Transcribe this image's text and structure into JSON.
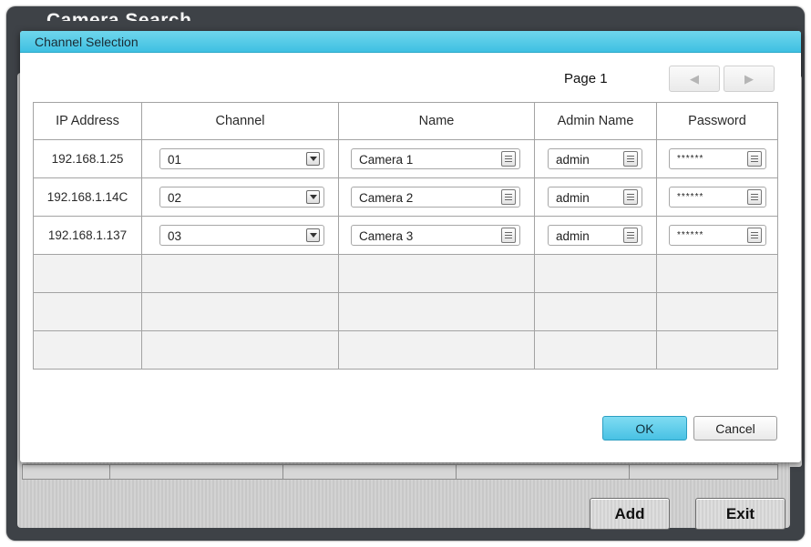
{
  "background_window": {
    "title": "Camera Search",
    "buttons": {
      "add": "Add",
      "exit": "Exit"
    }
  },
  "dialog": {
    "title": "Channel Selection",
    "page_label": "Page 1",
    "nav": {
      "prev_icon": "triangle-left",
      "next_icon": "triangle-right"
    },
    "columns": [
      "IP Address",
      "Channel",
      "Name",
      "Admin Name",
      "Password"
    ],
    "rows": [
      {
        "ip": "192.168.1.25",
        "channel": "01",
        "name": "Camera 1",
        "admin": "admin",
        "password": "******"
      },
      {
        "ip": "192.168.1.14C",
        "channel": "02",
        "name": "Camera 2",
        "admin": "admin",
        "password": "******"
      },
      {
        "ip": "192.168.1.137",
        "channel": "03",
        "name": "Camera 3",
        "admin": "admin",
        "password": "******"
      }
    ],
    "ok": "OK",
    "cancel": "Cancel"
  },
  "colors": {
    "accent": "#48c1e4",
    "title_bar": "#3fc0e2",
    "bg_window": "#3e4247"
  }
}
